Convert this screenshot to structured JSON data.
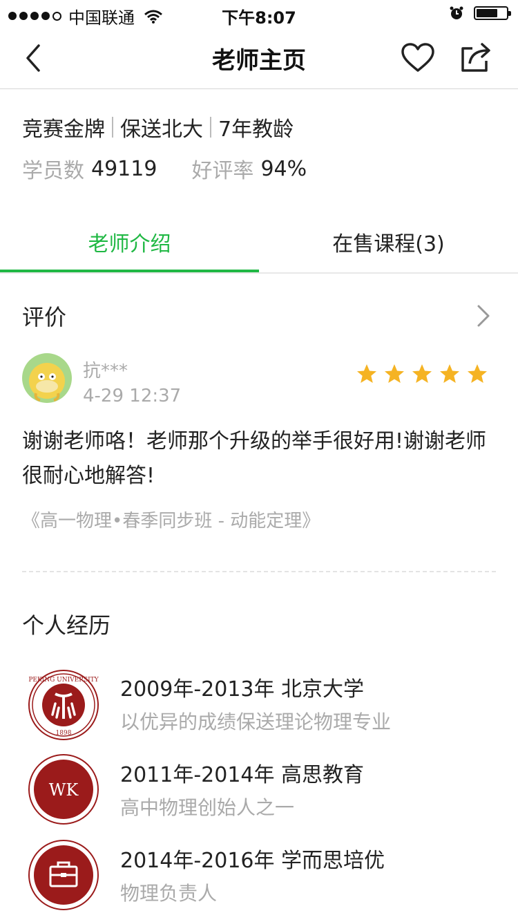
{
  "status_bar": {
    "carrier": "中国联通",
    "time": "下午8:07"
  },
  "nav": {
    "title": "老师主页",
    "back_icon": "chevron-left-icon",
    "favorite_icon": "heart-icon",
    "share_icon": "share-icon"
  },
  "teacher": {
    "tags": [
      "竞赛金牌",
      "保送北大",
      "7年教龄"
    ],
    "students_label": "学员数",
    "students_value": "49119",
    "rating_label": "好评率",
    "rating_value": "94%"
  },
  "tabs": [
    {
      "label": "老师介绍",
      "active": true
    },
    {
      "label": "在售课程(3)",
      "active": false
    }
  ],
  "review": {
    "section_title": "评价",
    "reviewer": "抗***",
    "time": "4-29 12:37",
    "stars": 5,
    "text": "谢谢老师咯！老师那个升级的举手很好用!谢谢老师很耐心地解答!",
    "course": "《高一物理•春季同步班 - 动能定理》"
  },
  "experience": {
    "section_title": "个人经历",
    "items": [
      {
        "title": "2009年-2013年 北京大学",
        "desc": "以优异的成绩保送理论物理专业",
        "logo_text": "PEKING UNIVERSITY 1898"
      },
      {
        "title": "2011年-2014年 高思教育",
        "desc": "高中物理创始人之一",
        "logo_text": "WK"
      },
      {
        "title": "2014年-2016年 学而思培优",
        "desc": "物理负责人",
        "logo_icon": "briefcase-icon"
      }
    ]
  },
  "colors": {
    "accent": "#20b844",
    "star": "#f5b323",
    "logo_red": "#9b1b1b"
  }
}
